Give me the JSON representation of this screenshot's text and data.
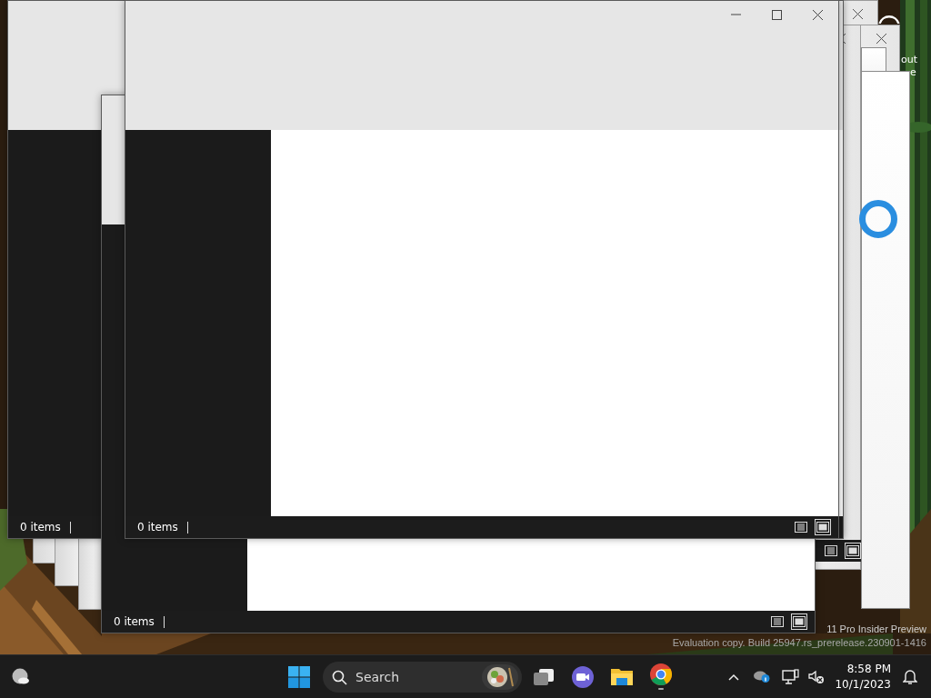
{
  "desktop": {
    "icon_label_fragments": [
      "out",
      "e"
    ],
    "watermark": [
      "11 Pro Insider Preview",
      "Evaluation copy. Build 25947.rs_prerelease.230901-1416"
    ]
  },
  "windows": [
    {
      "status": "0 items"
    },
    {
      "status": "0 items"
    },
    {
      "status": "0 items"
    }
  ],
  "taskbar": {
    "search": {
      "placeholder": "Search"
    },
    "time": "8:58 PM",
    "date": "10/1/2023"
  }
}
